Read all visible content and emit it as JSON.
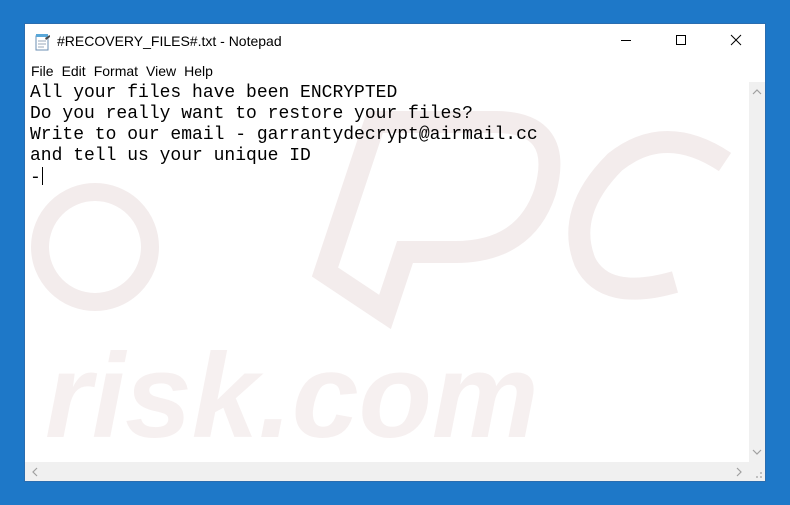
{
  "window": {
    "title": "#RECOVERY_FILES#.txt - Notepad"
  },
  "menubar": {
    "items": [
      "File",
      "Edit",
      "Format",
      "View",
      "Help"
    ]
  },
  "editor": {
    "lines": [
      "All your files have been ENCRYPTED",
      "Do you really want to restore your files?",
      "Write to our email - garrantydecrypt@airmail.cc",
      "and tell us your unique ID",
      "-"
    ]
  },
  "watermark": {
    "brand_text": "risk.com"
  },
  "icons": {
    "app": "notepad-icon",
    "minimize": "minimize-icon",
    "maximize": "maximize-icon",
    "close": "close-icon"
  },
  "colors": {
    "desktop": "#1e78c8",
    "window_bg": "#ffffff",
    "scrollbar": "#f0f0f0",
    "watermark": "#f3ecec"
  }
}
